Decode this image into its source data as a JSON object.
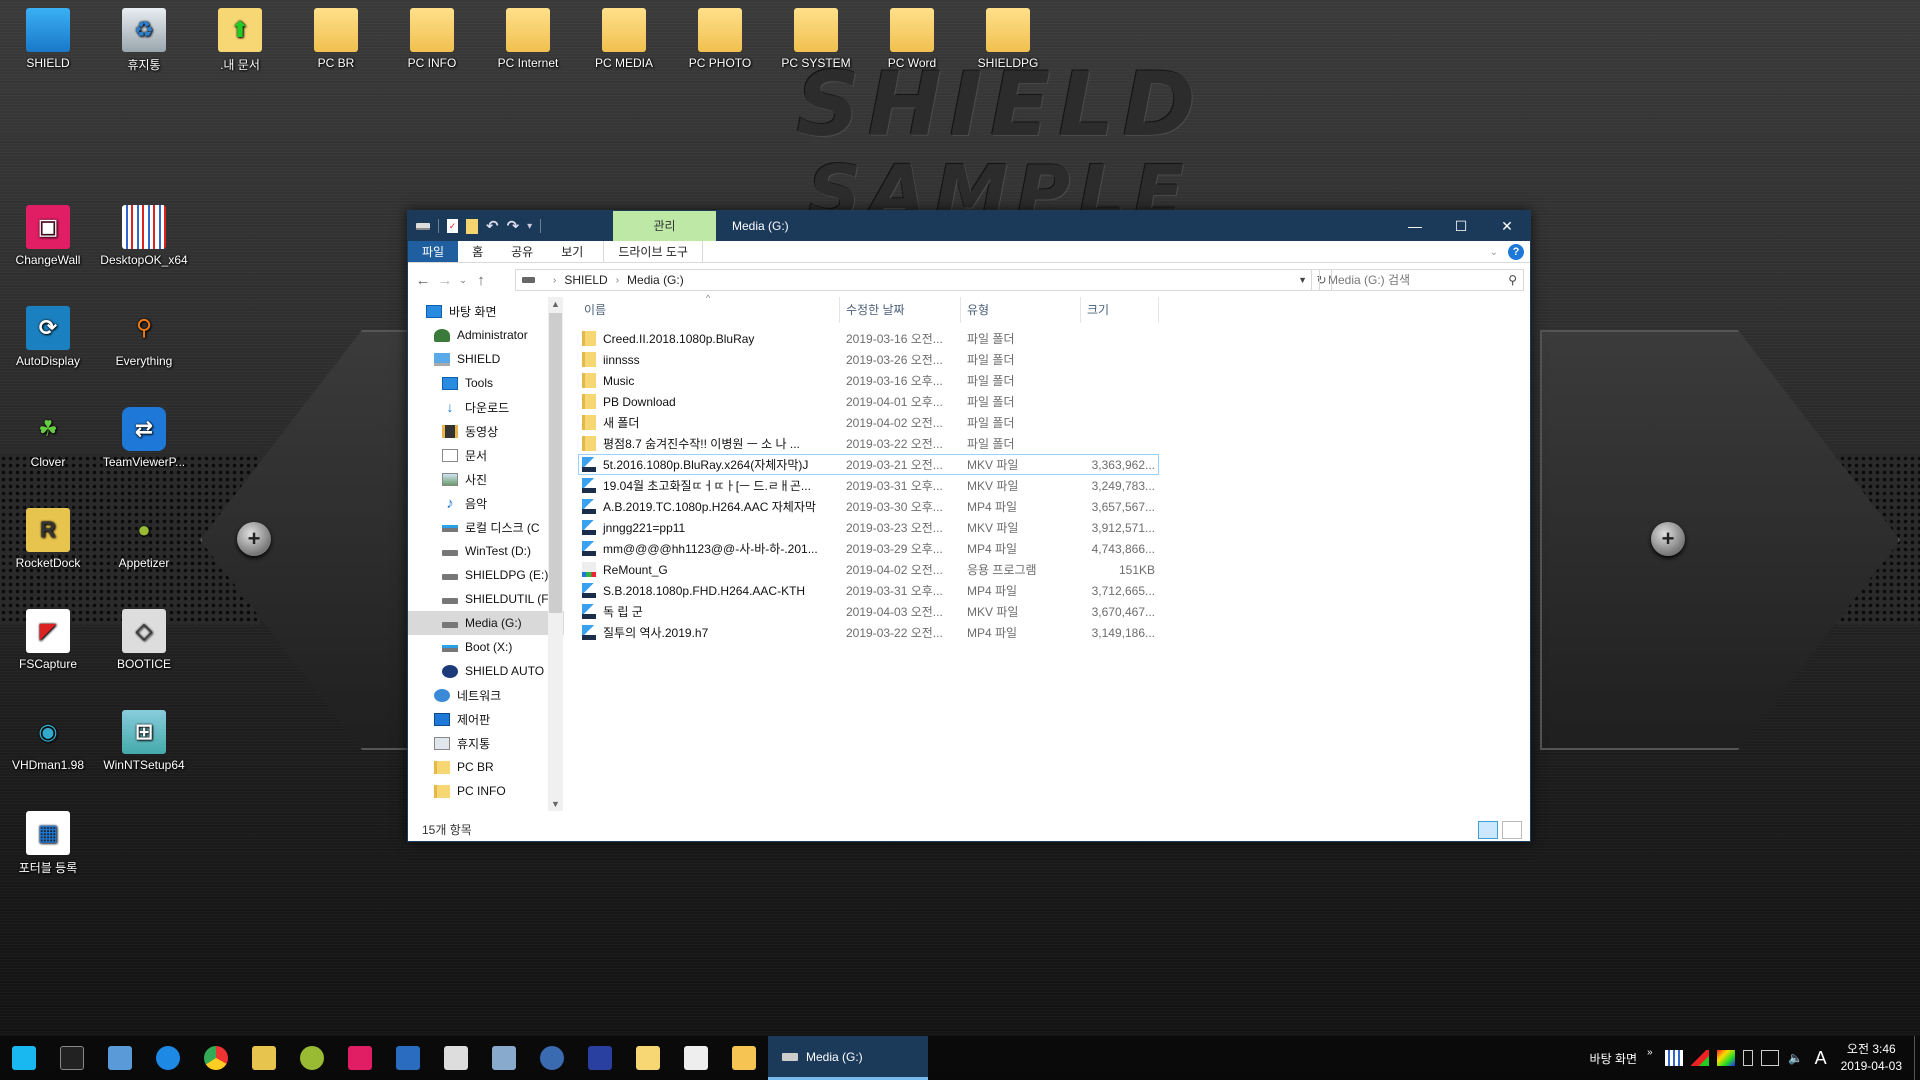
{
  "wallpaper": {
    "line1": "SHIELD",
    "line2": "SAMPLE"
  },
  "desktop_icons": [
    {
      "label": "SHIELD",
      "icon": "computer-icon"
    },
    {
      "label": "휴지통",
      "icon": "recycle-bin-icon"
    },
    {
      "label": ".내 문서",
      "icon": "documents-folder-icon"
    },
    {
      "label": "PC BR",
      "icon": "folder-icon"
    },
    {
      "label": "PC INFO",
      "icon": "folder-icon"
    },
    {
      "label": "PC Internet",
      "icon": "folder-icon"
    },
    {
      "label": "PC MEDIA",
      "icon": "folder-icon"
    },
    {
      "label": "PC PHOTO",
      "icon": "folder-icon"
    },
    {
      "label": "PC SYSTEM",
      "icon": "folder-icon"
    },
    {
      "label": "PC Word",
      "icon": "folder-icon"
    },
    {
      "label": "SHIELDPG",
      "icon": "folder-icon"
    },
    {
      "label": "ChangeWall",
      "icon": "changewall-icon"
    },
    {
      "label": "DesktopOK_x64",
      "icon": "desktopok-icon"
    },
    {
      "label": "AutoDisplay",
      "icon": "autodisplay-icon"
    },
    {
      "label": "Everything",
      "icon": "everything-search-icon"
    },
    {
      "label": "Clover",
      "icon": "clover-icon"
    },
    {
      "label": "TeamViewerP...",
      "icon": "teamviewer-icon"
    },
    {
      "label": "RocketDock",
      "icon": "rocketdock-icon"
    },
    {
      "label": "Appetizer",
      "icon": "appetizer-icon"
    },
    {
      "label": "FSCapture",
      "icon": "fscapture-icon"
    },
    {
      "label": "BOOTICE",
      "icon": "bootice-icon"
    },
    {
      "label": "VHDman1.98",
      "icon": "vhdman-icon"
    },
    {
      "label": "WinNTSetup64",
      "icon": "winntsetup-icon"
    },
    {
      "label": "포터블 등록",
      "icon": "registry-icon"
    }
  ],
  "explorer": {
    "title": "Media (G:)",
    "context_tab": "관리",
    "ribbon_tabs": [
      "파일",
      "홈",
      "공유",
      "보기",
      "드라이브 도구"
    ],
    "breadcrumb": [
      "SHIELD",
      "Media (G:)"
    ],
    "search_placeholder": "Media (G:) 검색",
    "nav_items": [
      {
        "label": "바탕 화면",
        "icon": "desktop-icon",
        "indent": 0
      },
      {
        "label": "Administrator",
        "icon": "user-icon",
        "indent": 1
      },
      {
        "label": "SHIELD",
        "icon": "pc-icon",
        "indent": 1
      },
      {
        "label": "Tools",
        "icon": "desktop-icon",
        "indent": 2
      },
      {
        "label": "다운로드",
        "icon": "download-icon",
        "indent": 2
      },
      {
        "label": "동영상",
        "icon": "video-icon",
        "indent": 2
      },
      {
        "label": "문서",
        "icon": "document-icon",
        "indent": 2
      },
      {
        "label": "사진",
        "icon": "picture-icon",
        "indent": 2
      },
      {
        "label": "음악",
        "icon": "music-icon",
        "indent": 2
      },
      {
        "label": "로컬 디스크 (C",
        "icon": "windows-drive-icon",
        "indent": 2
      },
      {
        "label": "WinTest (D:)",
        "icon": "drive-icon",
        "indent": 2
      },
      {
        "label": "SHIELDPG (E:)",
        "icon": "drive-icon",
        "indent": 2
      },
      {
        "label": "SHIELDUTIL (F",
        "icon": "drive-icon",
        "indent": 2
      },
      {
        "label": "Media (G:)",
        "icon": "drive-icon",
        "indent": 2,
        "selected": true
      },
      {
        "label": "Boot (X:)",
        "icon": "windows-drive-icon",
        "indent": 2
      },
      {
        "label": "SHIELD AUTO",
        "icon": "shield-auto-icon",
        "indent": 2
      },
      {
        "label": "네트워크",
        "icon": "network-icon",
        "indent": 1
      },
      {
        "label": "제어판",
        "icon": "control-panel-icon",
        "indent": 1
      },
      {
        "label": "휴지통",
        "icon": "recycle-bin-icon",
        "indent": 1
      },
      {
        "label": "PC BR",
        "icon": "folder-icon",
        "indent": 1
      },
      {
        "label": "PC INFO",
        "icon": "folder-icon",
        "indent": 1
      }
    ],
    "columns": [
      "이름",
      "수정한 날짜",
      "유형",
      "크기"
    ],
    "files": [
      {
        "name": "Creed.II.2018.1080p.BluRay",
        "date": "2019-03-16 오전...",
        "type": "파일 폴더",
        "size": "",
        "kind": "folder"
      },
      {
        "name": "iinnsss",
        "date": "2019-03-26 오전...",
        "type": "파일 폴더",
        "size": "",
        "kind": "folder"
      },
      {
        "name": "Music",
        "date": "2019-03-16 오후...",
        "type": "파일 폴더",
        "size": "",
        "kind": "folder"
      },
      {
        "name": "PB Download",
        "date": "2019-04-01 오후...",
        "type": "파일 폴더",
        "size": "",
        "kind": "folder"
      },
      {
        "name": "새 폴더",
        "date": "2019-04-02 오전...",
        "type": "파일 폴더",
        "size": "",
        "kind": "folder"
      },
      {
        "name": "평점8.7 숨겨진수작!! 이병원 ㅡ 소 나 ...",
        "date": "2019-03-22 오전...",
        "type": "파일 폴더",
        "size": "",
        "kind": "folder"
      },
      {
        "name": "5t.2016.1080p.BluRay.x264(자체자막)J",
        "date": "2019-03-21 오전...",
        "type": "MKV 파일",
        "size": "3,363,962...",
        "kind": "video",
        "focused": true
      },
      {
        "name": "19.04월 초고화질ㄸㅓㄸㅏ[ㅡ 드.ㄹㅐ곤...",
        "date": "2019-03-31 오후...",
        "type": "MKV 파일",
        "size": "3,249,783...",
        "kind": "video"
      },
      {
        "name": "A.B.2019.TC.1080p.H264.AAC 자체자막",
        "date": "2019-03-30 오후...",
        "type": "MP4 파일",
        "size": "3,657,567...",
        "kind": "video"
      },
      {
        "name": "jnngg221=pp11",
        "date": "2019-03-23 오전...",
        "type": "MKV 파일",
        "size": "3,912,571...",
        "kind": "video"
      },
      {
        "name": "mm@@@@hh1123@@-사-바-하-.201...",
        "date": "2019-03-29 오후...",
        "type": "MP4 파일",
        "size": "4,743,866...",
        "kind": "video"
      },
      {
        "name": "ReMount_G",
        "date": "2019-04-02 오전...",
        "type": "응용 프로그램",
        "size": "151KB",
        "kind": "app"
      },
      {
        "name": "S.B.2018.1080p.FHD.H264.AAC-KTH",
        "date": "2019-03-31 오후...",
        "type": "MP4 파일",
        "size": "3,712,665...",
        "kind": "video"
      },
      {
        "name": "독 립 군",
        "date": "2019-04-03 오전...",
        "type": "MKV 파일",
        "size": "3,670,467...",
        "kind": "video"
      },
      {
        "name": "질투의 역사.2019.h7",
        "date": "2019-03-22 오전...",
        "type": "MP4 파일",
        "size": "3,149,186...",
        "kind": "video"
      }
    ],
    "status": "15개 항목"
  },
  "taskbar": {
    "pinned": [
      "biohazard-start-icon",
      "cmd-icon",
      "network-monitor-icon",
      "internet-explorer-icon",
      "chrome-icon",
      "rocketdock-icon",
      "appetizer-icon",
      "changewall-icon",
      "media-player-icon",
      "chip-icon",
      "notepad-icon",
      "search-person-icon",
      "save-disk-icon",
      "documents-folder-icon",
      "list-folder-icon",
      "file-explorer-icon"
    ],
    "active_window": "Media (G:)",
    "desktop_label": "바탕 화면",
    "clock_time": "오전 3:46",
    "clock_date": "2019-04-03",
    "ime": "A"
  }
}
